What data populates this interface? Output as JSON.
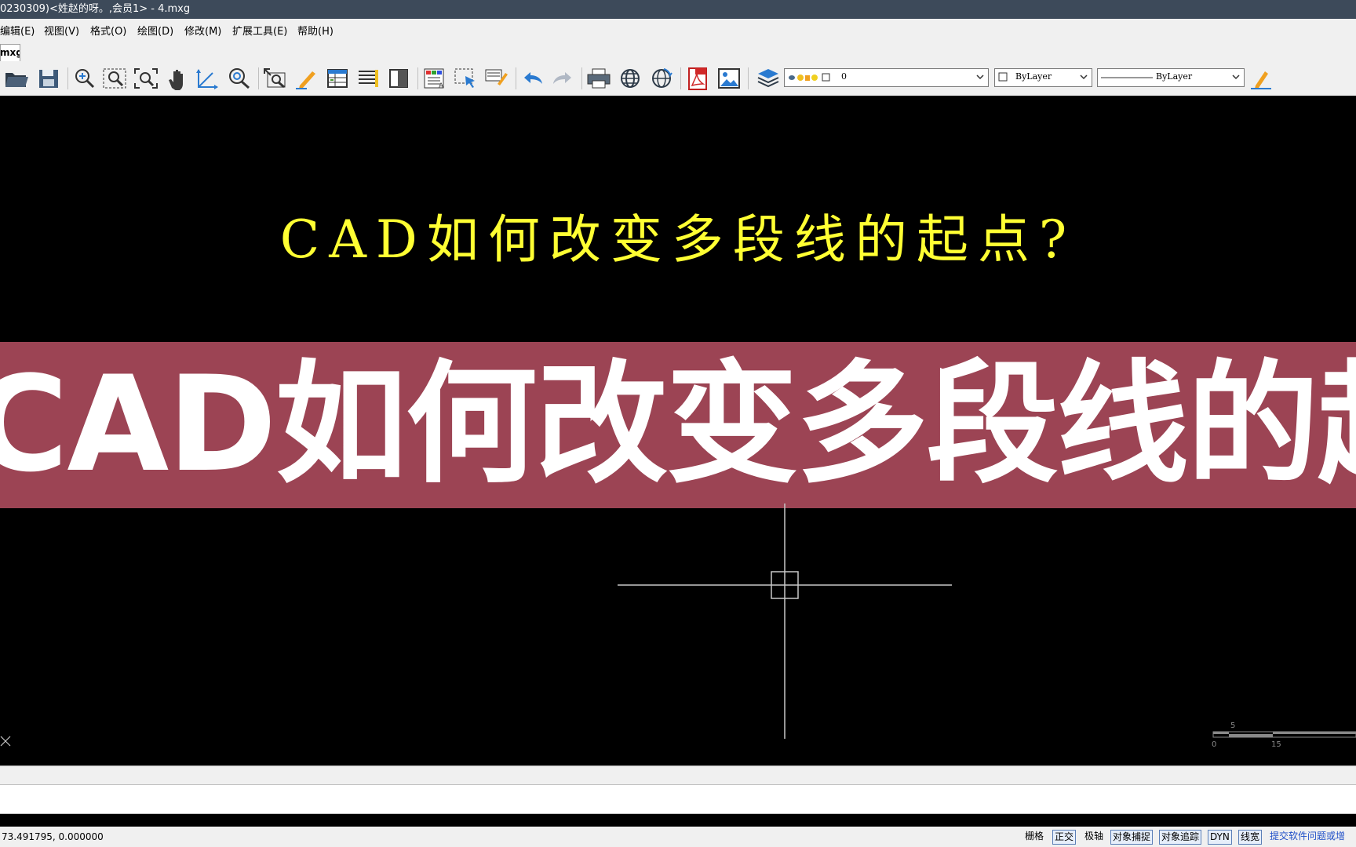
{
  "window": {
    "title": "0230309)<姓赵的呀。,会员1> - 4.mxg"
  },
  "menu": [
    "编辑(E)",
    "视图(V)",
    "格式(O)",
    "绘图(D)",
    "修改(M)",
    "扩展工具(E)",
    "帮助(H)"
  ],
  "tab": {
    "label": "mxg"
  },
  "toolbar": {
    "icons": [
      "open-folder-icon",
      "save-icon",
      "zoom-realtime-icon",
      "zoom-window-icon",
      "zoom-extents-icon",
      "pan-hand-icon",
      "ucs-axis-icon",
      "zoom-scale-icon",
      "zoom-previous-icon",
      "pencil-draw-icon",
      "properties-table-icon",
      "text-list-icon",
      "block-icon",
      "color-palette-icon",
      "select-arrow-icon",
      "match-brush-icon",
      "undo-icon",
      "redo-icon",
      "print-icon",
      "globe-icon",
      "globe-refresh-icon",
      "pdf-icon",
      "image-icon",
      "layers-icon"
    ],
    "layer_value": "0",
    "color_value": "ByLayer",
    "linetype_value": "ByLayer"
  },
  "canvas": {
    "drawing_text": "CAD如何改变多段线的起点?",
    "banner_text": "CAD如何改变多段线的起点",
    "scale_labels": [
      "5",
      "0",
      "15"
    ]
  },
  "status": {
    "coords": "73.491795,  0.000000",
    "buttons": [
      {
        "label": "栅格",
        "on": false
      },
      {
        "label": "正交",
        "on": true
      },
      {
        "label": "极轴",
        "on": false
      },
      {
        "label": "对象捕捉",
        "on": true
      },
      {
        "label": "对象追踪",
        "on": true
      },
      {
        "label": "DYN",
        "on": true
      },
      {
        "label": "线宽",
        "on": true
      }
    ],
    "feedback_link": "提交软件问题或增"
  },
  "colors": {
    "banner": "#9c4454",
    "drawing_text": "#ffff33",
    "background": "#000000"
  }
}
